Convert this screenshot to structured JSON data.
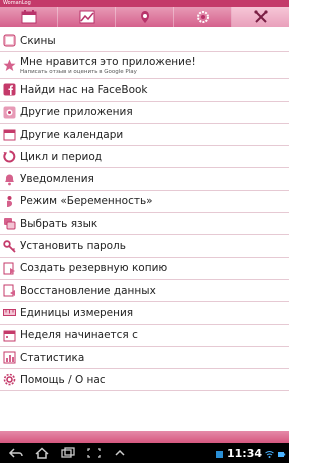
{
  "app": {
    "title": "WomanLog"
  },
  "tabs": [
    {
      "icon": "calendar-icon",
      "active": false
    },
    {
      "icon": "chart-icon",
      "active": false
    },
    {
      "icon": "profile-icon",
      "active": false
    },
    {
      "icon": "flower-icon",
      "active": false
    },
    {
      "icon": "tools-icon",
      "active": true
    }
  ],
  "menu": {
    "items": [
      {
        "label": "Скины",
        "icon": "skins-icon"
      },
      {
        "label": "Мне нравится это приложение!",
        "sub": "Написать отзыв и оценить в Google Play",
        "icon": "star-icon"
      },
      {
        "label": "Найди нас на FaceBook",
        "icon": "facebook-icon"
      },
      {
        "label": "Другие приложения",
        "icon": "apps-icon"
      },
      {
        "label": "Другие календари",
        "icon": "calendars-icon"
      },
      {
        "label": "Цикл и период",
        "icon": "cycle-icon"
      },
      {
        "label": "Уведомления",
        "icon": "notifications-icon"
      },
      {
        "label": "Режим «Беременность»",
        "icon": "pregnancy-icon"
      },
      {
        "label": "Выбрать язык",
        "icon": "language-icon"
      },
      {
        "label": "Установить пароль",
        "icon": "key-icon"
      },
      {
        "label": "Создать резервную копию",
        "icon": "backup-icon"
      },
      {
        "label": "Восстановление данных",
        "icon": "restore-icon"
      },
      {
        "label": "Единицы измерения",
        "icon": "units-icon"
      },
      {
        "label": "Неделя начинается с",
        "icon": "week-icon"
      },
      {
        "label": "Статистика",
        "icon": "statistics-icon"
      },
      {
        "label": "Помощь / О нас",
        "icon": "help-icon"
      }
    ]
  },
  "statusbar": {
    "time": "11:34"
  },
  "colors": {
    "accent": "#d5618c",
    "title": "#c43a6a",
    "divider": "#e6c9d3"
  }
}
